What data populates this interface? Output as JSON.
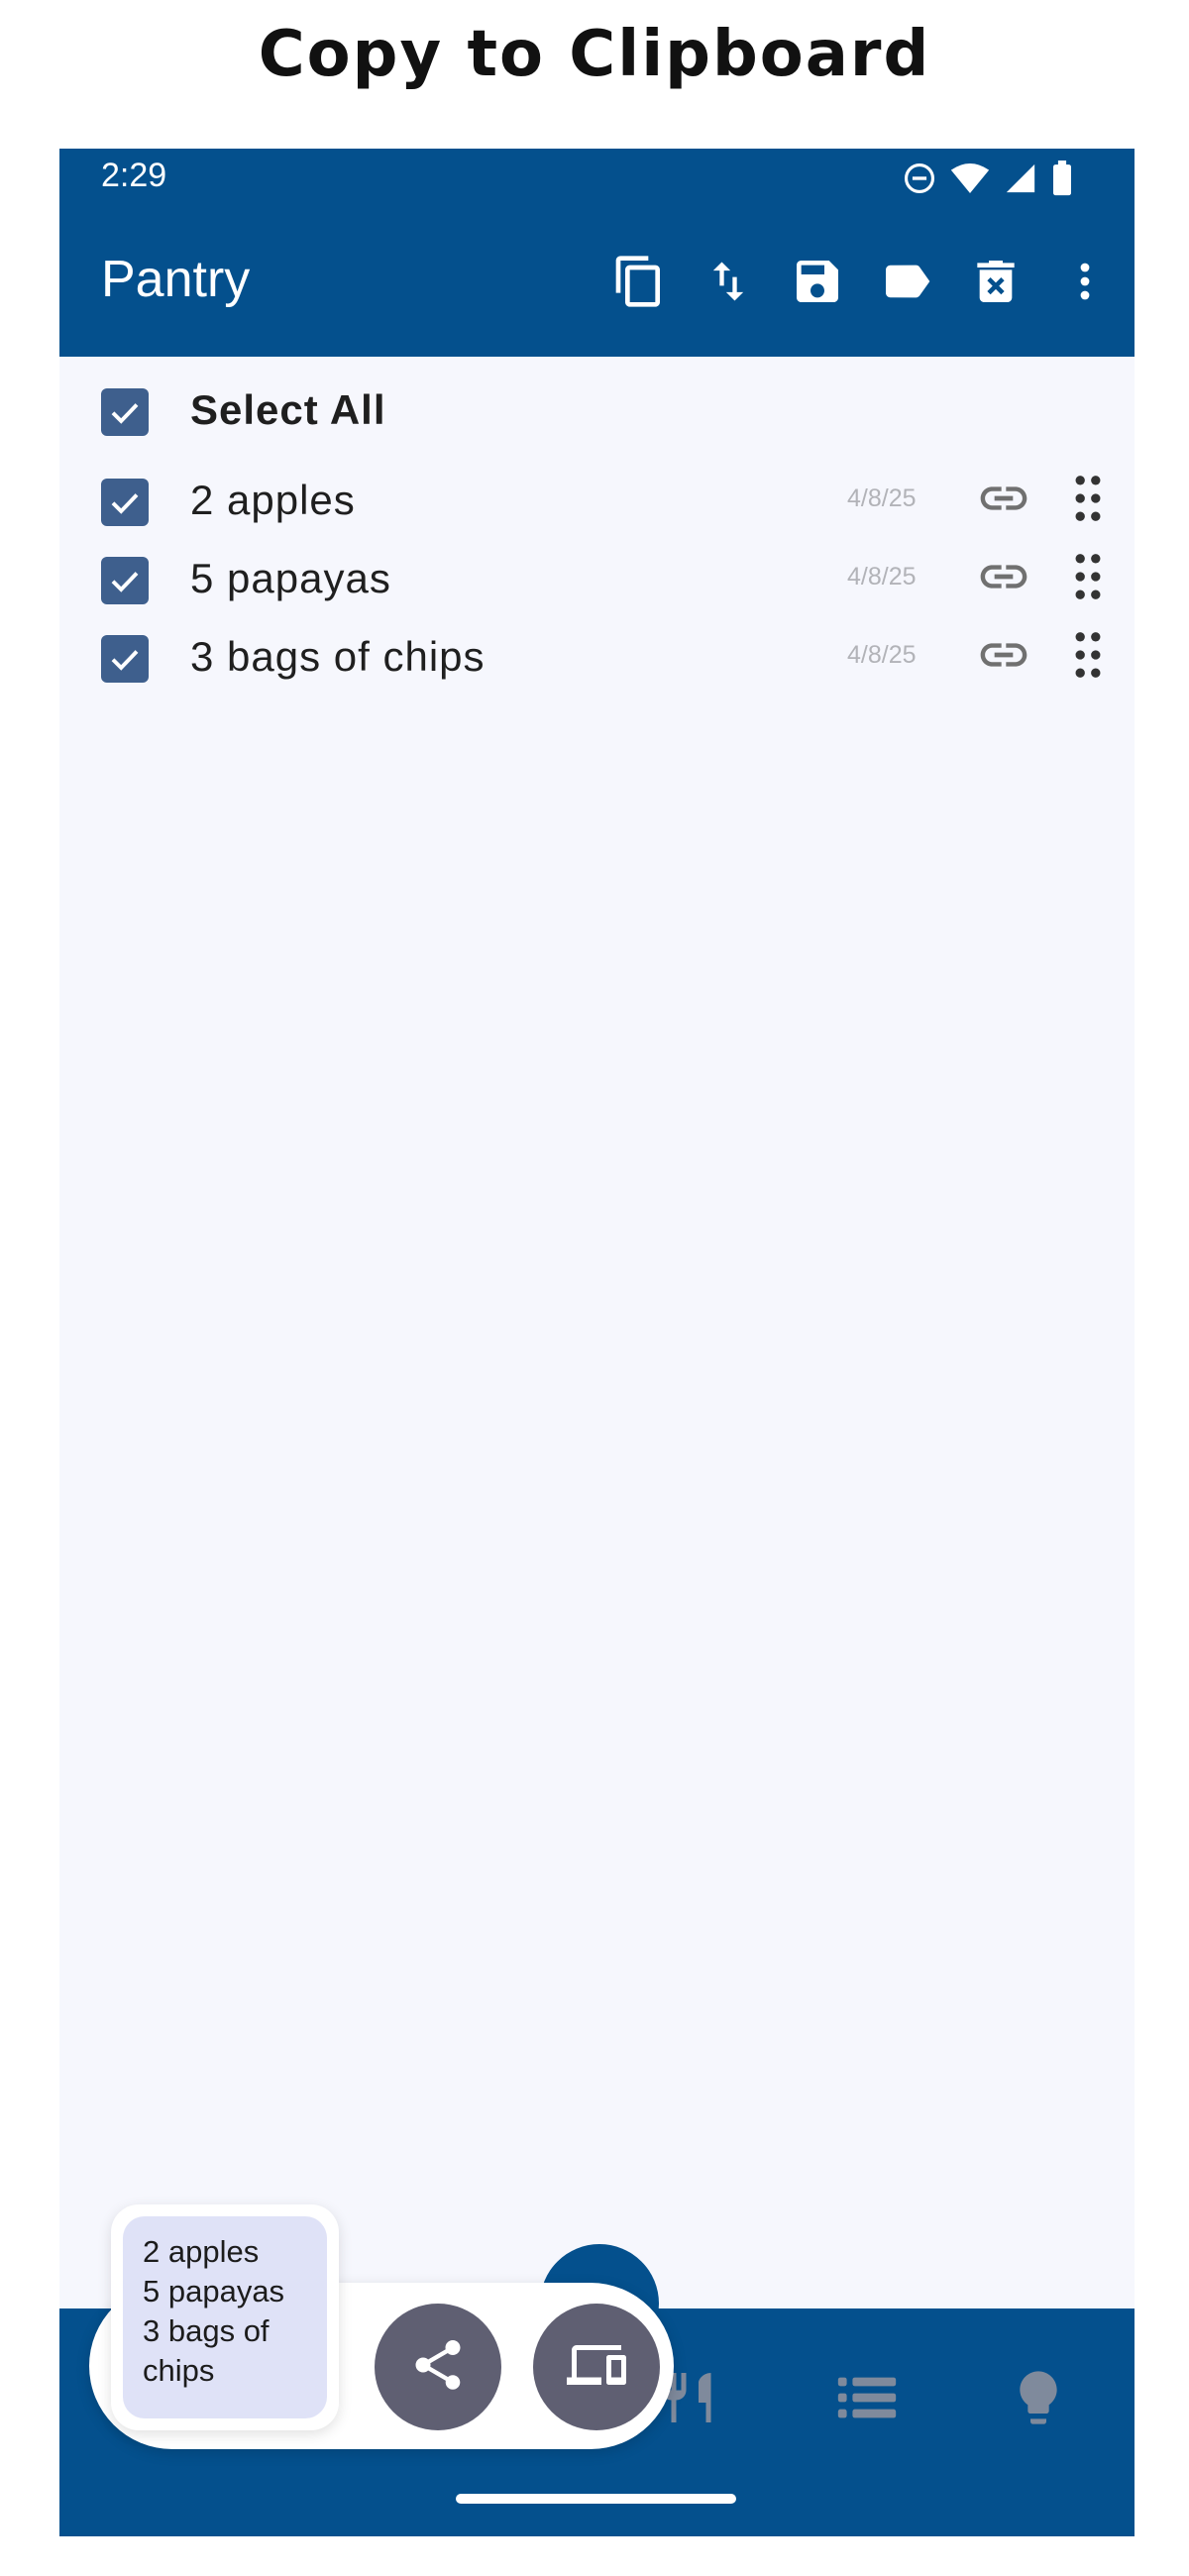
{
  "caption": "Copy to Clipboard",
  "status_bar": {
    "time": "2:29"
  },
  "app_bar": {
    "title": "Pantry",
    "actions": [
      "copy-icon",
      "sort-icon",
      "save-icon",
      "label-icon",
      "delete-icon",
      "more-vert-icon"
    ]
  },
  "list": {
    "select_all_label": "Select All",
    "items": [
      {
        "label": "2 apples",
        "date": "4/8/25",
        "checked": true
      },
      {
        "label": "5 papayas",
        "date": "4/8/25",
        "checked": true
      },
      {
        "label": "3 bags of chips",
        "date": "4/8/25",
        "checked": true
      }
    ]
  },
  "clipboard_preview": {
    "lines": [
      "2 apples",
      "5 papayas",
      "3 bags of",
      "chips"
    ]
  },
  "bottom_nav": {
    "icons": [
      "restaurant-icon",
      "list-icon",
      "lightbulb-icon"
    ]
  },
  "colors": {
    "primary": "#04508d",
    "checkbox": "#3e5f8d",
    "background": "#f6f7fd",
    "clipboard_bg": "#dfe2f7",
    "action_button": "#5f5f72"
  }
}
